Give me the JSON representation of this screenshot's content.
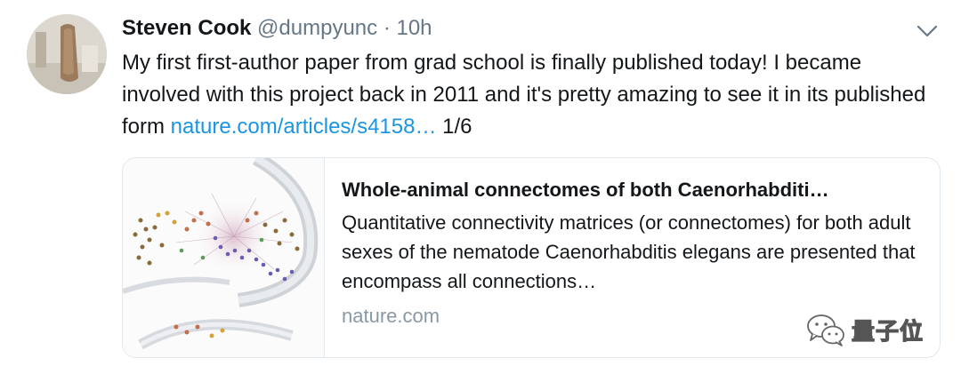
{
  "tweet": {
    "author_name": "Steven Cook",
    "handle": "@dumpyunc",
    "separator": "·",
    "time": "10h",
    "body_text": "My first first-author paper from grad school is finally published today! I became involved with this project back in 2011 and it's pretty amazing to see it in its published form ",
    "link_text": "nature.com/articles/s4158…",
    "suffix": " 1/6",
    "avatar_icon": "user-avatar-photo",
    "menu_icon": "chevron-down-icon"
  },
  "card": {
    "title": "Whole-animal connectomes of both Caenorhabditi…",
    "description": "Quantitative connectivity matrices (or connectomes) for both adult sexes of the nematode Caenorhabditis elegans are presented that encompass all connections…",
    "domain": "nature.com",
    "image_icon": "connectome-thumbnail"
  },
  "watermark": {
    "text": "量子位",
    "icon": "wechat-logo"
  },
  "colors": {
    "link": "#1b95e0",
    "secondary_text": "#657786",
    "border": "#e1e8ed"
  }
}
